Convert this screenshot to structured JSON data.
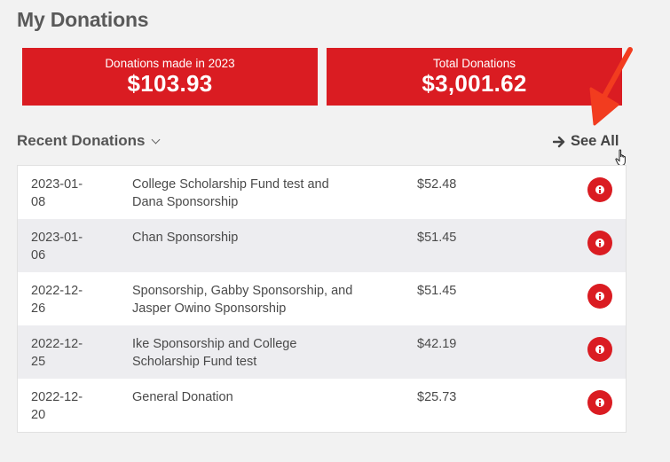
{
  "page": {
    "title": "My Donations"
  },
  "stats": {
    "year_label": "Donations made in 2023",
    "year_value": "$103.93",
    "total_label": "Total Donations",
    "total_value": "$3,001.62"
  },
  "recent": {
    "header": "Recent Donations",
    "see_all_label": "See All"
  },
  "donations": [
    {
      "date_line1": "2023-01-",
      "date_line2": "08",
      "description": "College Scholarship Fund test and Dana Sponsorship",
      "amount": "$52.48"
    },
    {
      "date_line1": "2023-01-",
      "date_line2": "06",
      "description": "Chan Sponsorship",
      "amount": "$51.45"
    },
    {
      "date_line1": "2022-12-",
      "date_line2": "26",
      "description": "Sponsorship, Gabby Sponsorship, and Jasper Owino Sponsorship",
      "amount": "$51.45"
    },
    {
      "date_line1": "2022-12-",
      "date_line2": "25",
      "description": "Ike Sponsorship and College Scholarship Fund test",
      "amount": "$42.19"
    },
    {
      "date_line1": "2022-12-",
      "date_line2": "20",
      "description": "General Donation",
      "amount": "$25.73"
    }
  ],
  "colors": {
    "brand_red": "#da1c22",
    "annotation_arrow": "#f23c1f",
    "background": "#f2f2f2",
    "row_alt": "#ededf0"
  },
  "icons": {
    "info": "info-icon",
    "see_all_arrow": "arrow-right-icon",
    "chevron": "chevron-down-icon",
    "cursor": "hand-pointer-cursor-icon",
    "annotation": "annotation-arrow-icon"
  }
}
